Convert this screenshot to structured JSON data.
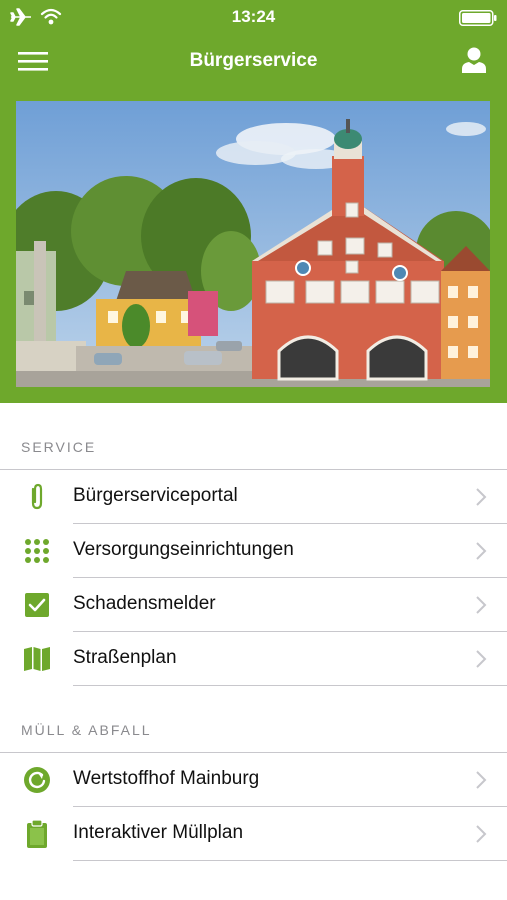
{
  "status_bar": {
    "time": "13:24",
    "icons": [
      "airplane-icon",
      "wifi-icon",
      "battery-icon"
    ]
  },
  "header": {
    "title": "Bürgerservice",
    "menu_icon": "hamburger-menu-icon",
    "user_icon": "user-icon"
  },
  "colors": {
    "brand_green": "#6ea82c",
    "separator": "#c8c7cc",
    "section_text": "#8a8a8e"
  },
  "sections": [
    {
      "title": "SERVICE",
      "items": [
        {
          "label": "Bürgerserviceportal",
          "icon": "paperclip-icon"
        },
        {
          "label": "Versorgungseinrichtungen",
          "icon": "grid-dots-icon"
        },
        {
          "label": "Schadensmelder",
          "icon": "checkbox-icon"
        },
        {
          "label": "Straßenplan",
          "icon": "map-icon"
        }
      ]
    },
    {
      "title": "MÜLL & ABFALL",
      "items": [
        {
          "label": "Wertstoffhof Mainburg",
          "icon": "recycle-icon"
        },
        {
          "label": "Interaktiver Müllplan",
          "icon": "clipboard-icon"
        }
      ]
    }
  ]
}
